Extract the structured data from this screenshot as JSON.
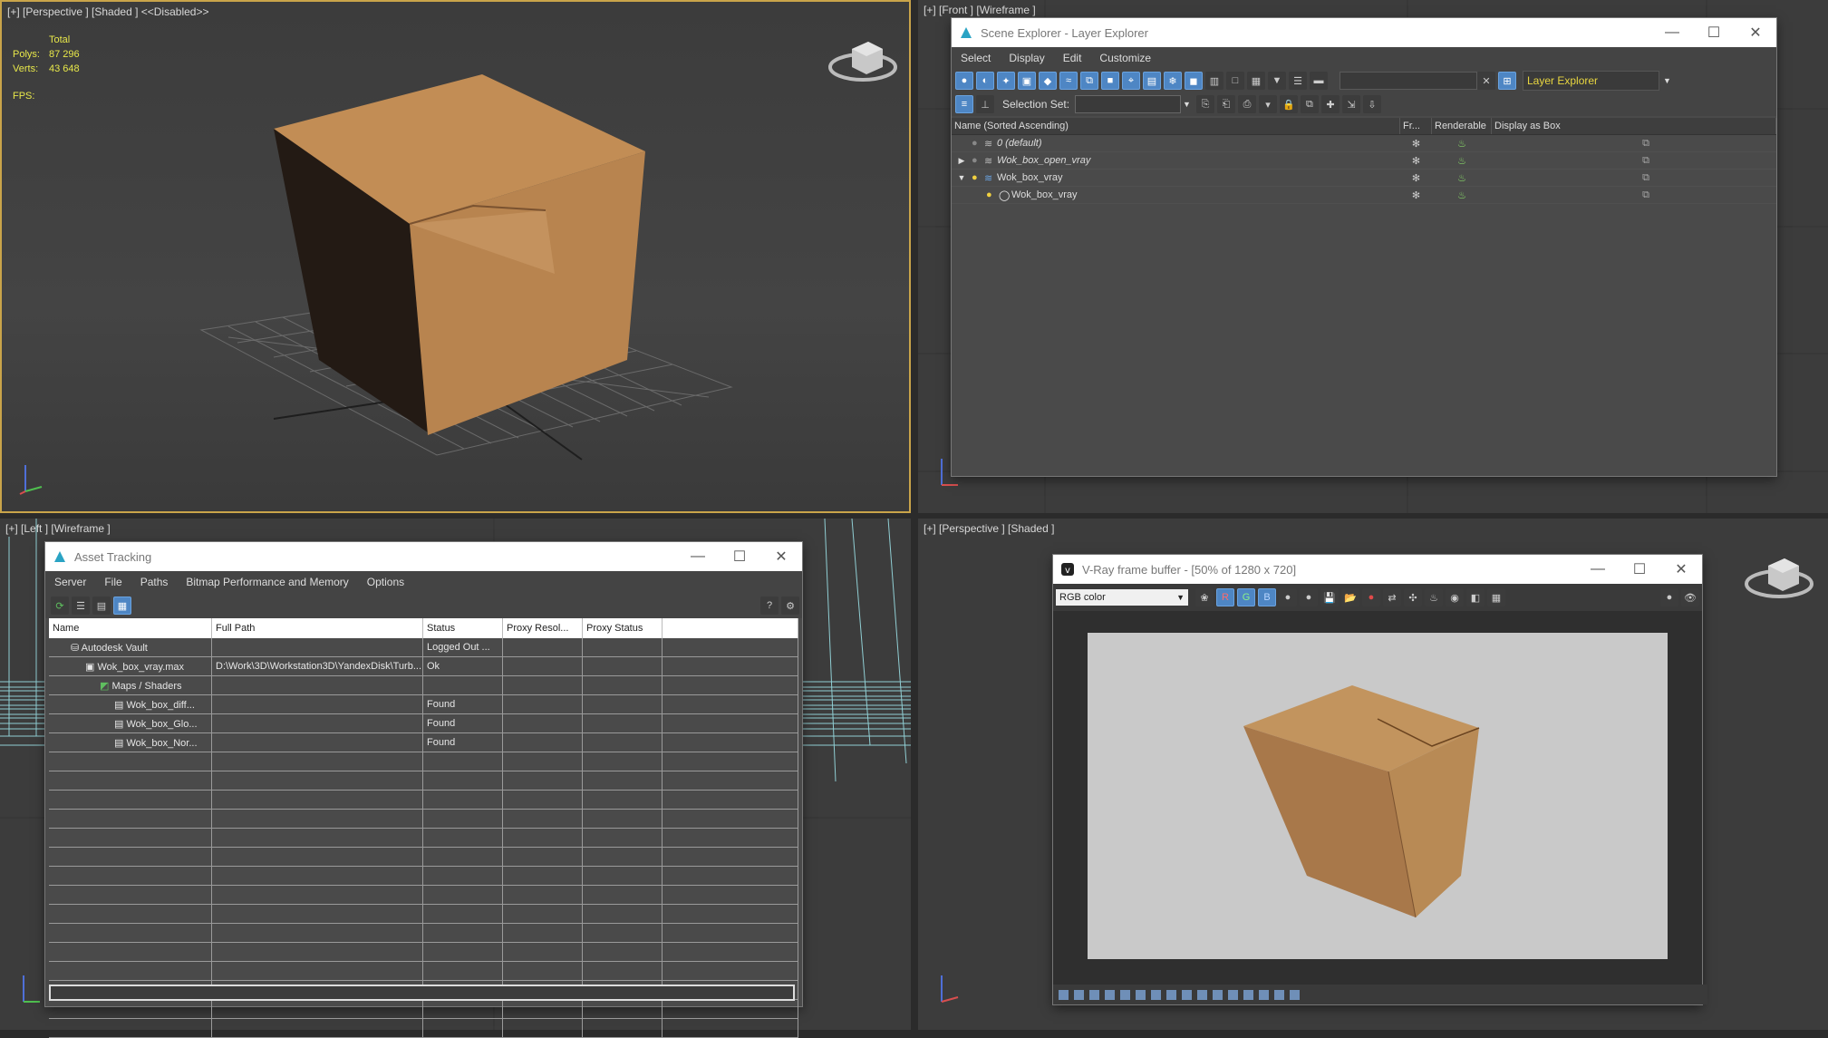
{
  "viewports": {
    "top_left": {
      "label": "[+] [Perspective ] [Shaded ]  <<Disabled>>"
    },
    "top_right": {
      "label": "[+] [Front ] [Wireframe ]"
    },
    "bottom_left": {
      "label": "[+] [Left ] [Wireframe ]"
    },
    "bottom_right": {
      "label": "[+] [Perspective ] [Shaded ]"
    }
  },
  "stats": {
    "total_label": "Total",
    "polys_label": "Polys:",
    "polys_value": "87 296",
    "verts_label": "Verts:",
    "verts_value": "43 648",
    "fps_label": "FPS:"
  },
  "scene_explorer": {
    "title": "Scene Explorer - Layer Explorer",
    "menu": [
      "Select",
      "Display",
      "Edit",
      "Customize"
    ],
    "layer_dropdown": "Layer Explorer",
    "selection_set_label": "Selection Set:",
    "columns": [
      "Name (Sorted Ascending)",
      "Fr...",
      "Renderable",
      "Display as Box"
    ],
    "rows": [
      {
        "name": "0 (default)",
        "italic": true,
        "indent": 1
      },
      {
        "name": "Wok_box_open_vray",
        "italic": true,
        "indent": 1
      },
      {
        "name": "Wok_box_vray",
        "italic": false,
        "indent": 1
      },
      {
        "name": "Wok_box_vray",
        "italic": false,
        "indent": 2
      }
    ]
  },
  "asset_tracking": {
    "title": "Asset Tracking",
    "menu": [
      "Server",
      "File",
      "Paths",
      "Bitmap Performance and Memory",
      "Options"
    ],
    "columns": [
      "Name",
      "Full Path",
      "Status",
      "Proxy Resol...",
      "Proxy Status"
    ],
    "rows": [
      {
        "name": "Autodesk Vault",
        "path": "",
        "status": "Logged Out ...",
        "indent": 1
      },
      {
        "name": "Wok_box_vray.max",
        "path": "D:\\Work\\3D\\Workstation3D\\YandexDisk\\Turb...",
        "status": "Ok",
        "indent": 2
      },
      {
        "name": "Maps / Shaders",
        "path": "",
        "status": "",
        "indent": 3
      },
      {
        "name": "Wok_box_diff...",
        "path": "",
        "status": "Found",
        "indent": 4
      },
      {
        "name": "Wok_box_Glo...",
        "path": "",
        "status": "Found",
        "indent": 4
      },
      {
        "name": "Wok_box_Nor...",
        "path": "",
        "status": "Found",
        "indent": 4
      }
    ]
  },
  "vfb": {
    "title": "V-Ray frame buffer - [50% of 1280 x 720]",
    "channel": "RGB color",
    "r": "R",
    "g": "G",
    "b": "B"
  }
}
